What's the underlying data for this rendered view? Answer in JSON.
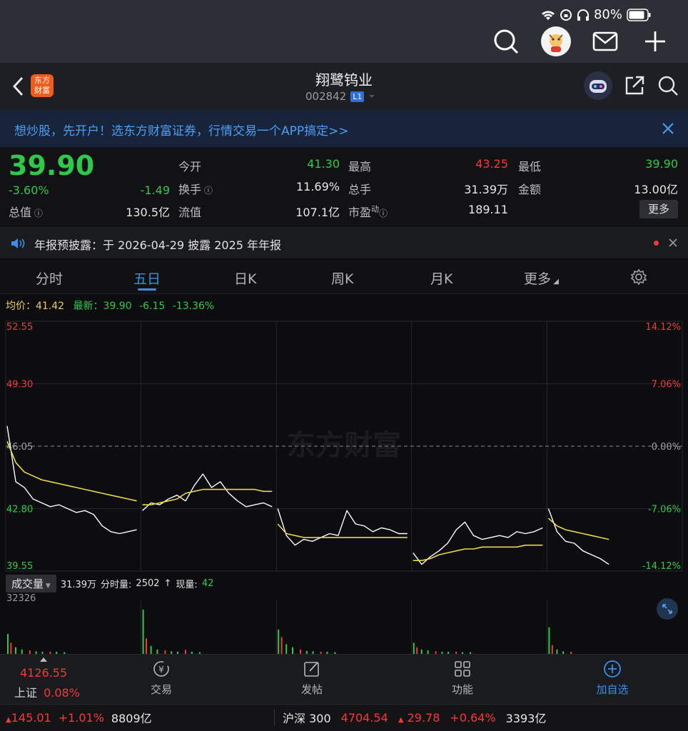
{
  "status": {
    "battery": "80%"
  },
  "header": {
    "title": "翔鹭钨业",
    "code": "002842",
    "level_badge": "L1",
    "logo_text_1": "东方",
    "logo_text_2": "财富"
  },
  "banner": {
    "text": "想炒股，先开户！选东方财富证券，行情交易一个APP搞定>>"
  },
  "quote": {
    "price": "39.90",
    "change_pct": "-3.60%",
    "change": "-1.49",
    "total_value_label": "总值",
    "total_value": "130.5亿",
    "open_label": "今开",
    "open": "41.30",
    "turnover_label": "换手",
    "turnover": "11.69%",
    "float_label": "流值",
    "float": "107.1亿",
    "high_label": "最高",
    "high": "43.25",
    "volume_label": "总手",
    "volume": "31.39万",
    "pe_label": "市盈",
    "pe_sup": "动",
    "pe": "189.11",
    "low_label": "最低",
    "low": "39.90",
    "amount_label": "金额",
    "amount": "13.00亿",
    "more": "更多"
  },
  "notice": {
    "text": "年报预披露：于 2026-04-29 披露 2025 年年报"
  },
  "tabs": [
    "分时",
    "五日",
    "日K",
    "周K",
    "月K",
    "更多"
  ],
  "legend": {
    "avg_label": "均价：",
    "avg": "41.42",
    "latest_label": "最新：",
    "latest": "39.90",
    "latest_change": "-6.15",
    "latest_pct": "-13.36%"
  },
  "chart_data": {
    "type": "line",
    "y_left_ticks": [
      "52.55",
      "49.30",
      "46.05",
      "42.80",
      "39.55"
    ],
    "y_right_ticks": [
      "14.12%",
      "7.06%",
      "0.00%",
      "-7.06%",
      "-14.12%"
    ],
    "ylim": [
      39.55,
      52.55
    ],
    "reference": 46.05,
    "days": 5,
    "watermark": "东方财富",
    "series": [
      {
        "values": [
          [
            47.1,
            44.2,
            43.9,
            43.3,
            43.1,
            42.9,
            43.0,
            42.8,
            42.6,
            42.7,
            42.5,
            41.9,
            41.6,
            41.5,
            41.6,
            41.7
          ],
          [
            42.7,
            43.1,
            43.0,
            43.3,
            43.5,
            43.2,
            44.0,
            44.6,
            43.9,
            44.2,
            43.6,
            43.2,
            42.9,
            43.0,
            43.1,
            42.9
          ],
          [
            42.8,
            41.4,
            40.9,
            41.2,
            41.1,
            41.3,
            41.5,
            41.4,
            42.7,
            42.0,
            41.9,
            41.6,
            41.8,
            41.7,
            41.5,
            41.5
          ],
          [
            40.5,
            39.9,
            40.3,
            40.6,
            41.0,
            41.7,
            42.1,
            41.4,
            41.2,
            41.3,
            41.4,
            41.3,
            41.6,
            41.5,
            41.6,
            41.8
          ],
          [
            42.8,
            41.6,
            41.1,
            41.0,
            40.6,
            40.4,
            40.2,
            39.9
          ]
        ],
        "color": "#ffffff"
      },
      {
        "values": [
          [
            46.3,
            45.2,
            44.7,
            44.5,
            44.3,
            44.2,
            44.1,
            44.0,
            43.9,
            43.8,
            43.7,
            43.6,
            43.5,
            43.4,
            43.3,
            43.2
          ],
          [
            43.0,
            43.0,
            43.1,
            43.2,
            43.3,
            43.6,
            43.7,
            43.8,
            43.8,
            43.8,
            43.8,
            43.8,
            43.8,
            43.8,
            43.7,
            43.7
          ],
          [
            42.0,
            41.5,
            41.4,
            41.3,
            41.3,
            41.3,
            41.3,
            41.3,
            41.3,
            41.3,
            41.3,
            41.3,
            41.3,
            41.3,
            41.3,
            41.3
          ],
          [
            40.1,
            40.1,
            40.2,
            40.4,
            40.5,
            40.6,
            40.7,
            40.7,
            40.8,
            40.8,
            40.8,
            40.8,
            40.8,
            40.9,
            40.9,
            40.9
          ],
          [
            42.3,
            41.9,
            41.7,
            41.6,
            41.5,
            41.4,
            41.3,
            41.2
          ]
        ],
        "color": "#e8d94a"
      }
    ]
  },
  "volume": {
    "selector": "成交量",
    "summary_total": "31.39万",
    "summary_minute_label": "分时量:",
    "summary_minute": "2502",
    "summary_now_label": "现量:",
    "summary_now": "42",
    "max_label": "32326",
    "bars": [
      [
        0.45,
        0.25,
        0.15,
        0.1,
        0.08,
        0.06,
        0.05,
        0.05,
        0.05,
        0.04
      ],
      [
        1.0,
        0.35,
        0.18,
        0.1,
        0.08,
        0.06,
        0.05,
        0.09,
        0.05,
        0.04
      ],
      [
        0.55,
        0.38,
        0.22,
        0.15,
        0.1,
        0.07,
        0.06,
        0.05,
        0.05,
        0.04
      ],
      [
        0.25,
        0.15,
        0.1,
        0.08,
        0.06,
        0.05,
        0.05,
        0.05,
        0.04,
        0.04
      ],
      [
        0.6,
        0.2,
        0.1,
        0.06,
        0.05
      ]
    ]
  },
  "bottomnav": {
    "index_value": "4126.55",
    "index_name": "上证",
    "index_pct": "0.08%",
    "items": [
      "交易",
      "发帖",
      "功能",
      "加自选"
    ]
  },
  "ticker": {
    "left_change": "145.01",
    "left_pct": "+1.01%",
    "left_amount": "8809亿",
    "name": "沪深 300",
    "value": "4704.54",
    "change": "29.78",
    "pct": "+0.64%",
    "amount": "3393亿"
  },
  "colors": {
    "up": "#f23a3a",
    "down": "#2ec94b",
    "accent": "#3c8fe6",
    "brand": "#f25c1a"
  }
}
